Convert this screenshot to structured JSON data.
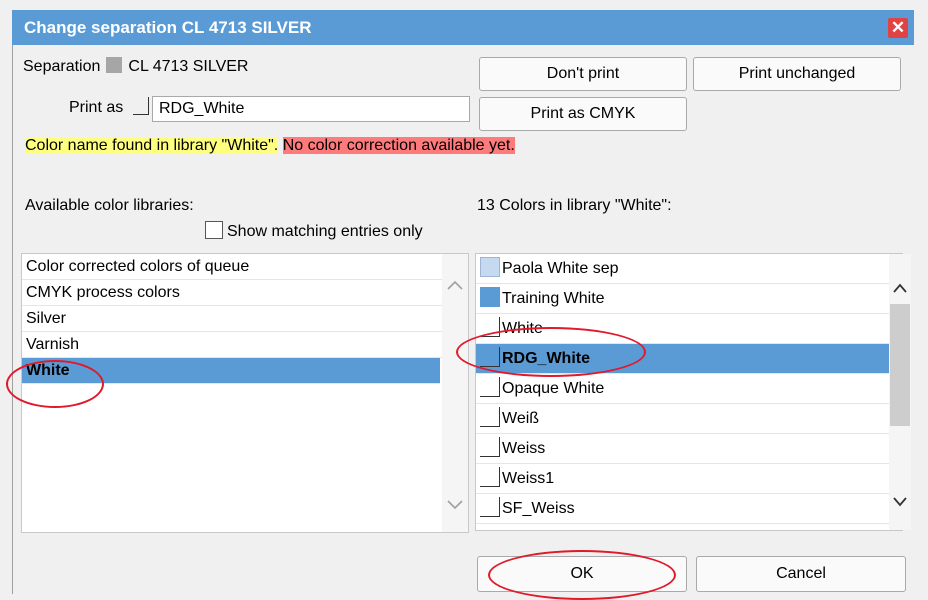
{
  "window": {
    "title": "Change separation CL 4713 SILVER",
    "close_symbol": "✕"
  },
  "separation": {
    "label": "Separation",
    "name": "CL 4713 SILVER",
    "swatch_color": "#a6a6a6"
  },
  "print_as": {
    "label": "Print as",
    "value": "RDG_White"
  },
  "buttons": {
    "dont_print": "Don't print",
    "print_unchanged": "Print unchanged",
    "print_as_cmyk": "Print as CMYK",
    "ok": "OK",
    "cancel": "Cancel"
  },
  "messages": {
    "found": "Color name found in library \"White\".",
    "warning": "No color correction available yet.",
    "found_bg": "#ffff7f",
    "warning_bg": "#ff7a7a"
  },
  "libraries": {
    "heading": "Available color libraries:",
    "show_matching_label": "Show matching entries only",
    "show_matching_checked": false,
    "items": [
      "Color corrected colors of queue",
      "CMYK process colors",
      "Silver",
      "Varnish",
      "White"
    ],
    "selected": "White"
  },
  "colors": {
    "heading": "13 Colors in library \"White\":",
    "items": [
      {
        "name": "Paola White sep",
        "swatch": "light"
      },
      {
        "name": "Training White",
        "swatch": "mid"
      },
      {
        "name": "White",
        "swatch": "line"
      },
      {
        "name": "RDG_White",
        "swatch": "line"
      },
      {
        "name": "Opaque White",
        "swatch": "line"
      },
      {
        "name": "Weiß",
        "swatch": "line"
      },
      {
        "name": "Weiss",
        "swatch": "line"
      },
      {
        "name": "Weiss1",
        "swatch": "line"
      },
      {
        "name": "SF_Weiss",
        "swatch": "line"
      }
    ],
    "selected": "RDG_White"
  },
  "colors_theme": {
    "title_bar": "#5b9bd5",
    "selection": "#5b9bd5",
    "annotation_circle": "#e0192b"
  },
  "icons": {
    "scroll_up": "chevron-up-icon",
    "scroll_down": "chevron-down-icon",
    "close": "close-icon"
  }
}
